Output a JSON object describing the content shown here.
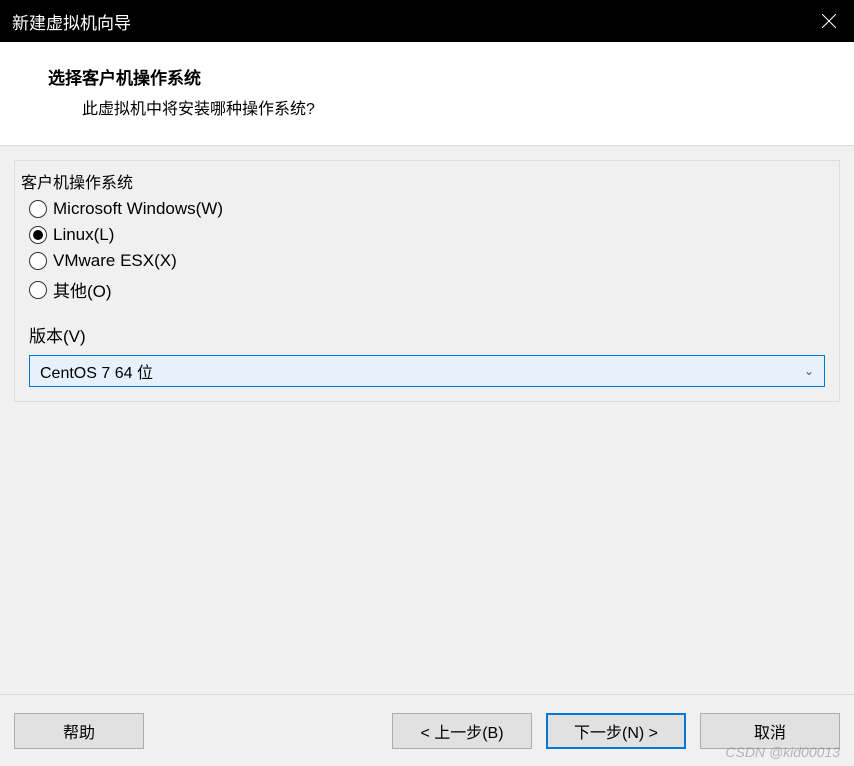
{
  "titlebar": {
    "title": "新建虚拟机向导"
  },
  "header": {
    "title": "选择客户机操作系统",
    "subtitle": "此虚拟机中将安装哪种操作系统?"
  },
  "os_group": {
    "legend": "客户机操作系统",
    "options": [
      {
        "label": "Microsoft Windows(W)",
        "selected": false
      },
      {
        "label": "Linux(L)",
        "selected": true
      },
      {
        "label": "VMware ESX(X)",
        "selected": false
      },
      {
        "label": "其他(O)",
        "selected": false
      }
    ]
  },
  "version": {
    "label": "版本(V)",
    "selected": "CentOS 7 64 位"
  },
  "footer": {
    "help": "帮助",
    "back": "< 上一步(B)",
    "next": "下一步(N) >",
    "cancel": "取消"
  },
  "watermark": "CSDN @kid00013"
}
